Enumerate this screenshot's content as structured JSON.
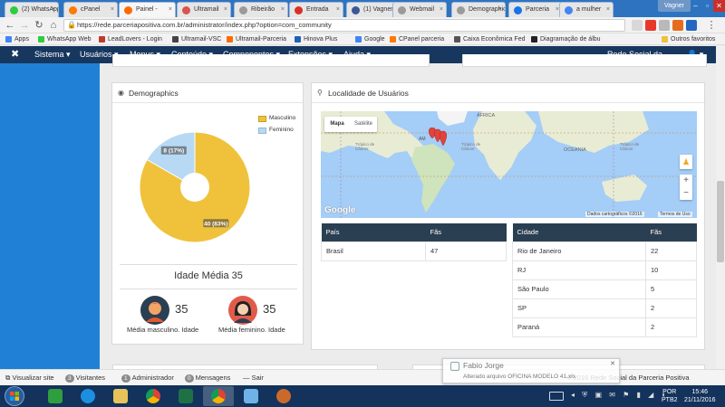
{
  "browser": {
    "tabs": [
      {
        "label": "(2) WhatsApp",
        "color": "#2ecc40"
      },
      {
        "label": "cPanel",
        "color": "#ff7a00"
      },
      {
        "label": "Painel - ",
        "color": "#ff6a00"
      },
      {
        "label": "Ultramail",
        "color": "#d9534f"
      },
      {
        "label": "Ribeirão",
        "color": "#9a9a9a"
      },
      {
        "label": "Entrada",
        "color": "#d93025"
      },
      {
        "label": "(1) Vagner",
        "color": "#3b5998"
      },
      {
        "label": "Webmail",
        "color": "#9a9a9a"
      },
      {
        "label": "Demographics",
        "color": "#9a9a9a"
      },
      {
        "label": "Parceria",
        "color": "#1a73e8"
      },
      {
        "label": "a mulher",
        "color": "#4285f4"
      }
    ],
    "user_name": "Vagner",
    "url": "https://rede.parceriapositiva.com.br/administrator/index.php?option=com_community",
    "bookmarks": [
      {
        "label": "Apps",
        "color": "#4285f4"
      },
      {
        "label": "WhatsApp Web",
        "color": "#2ecc40"
      },
      {
        "label": "LeadLovers - Login",
        "color": "#c0392b"
      },
      {
        "label": "Ultramail-VSC",
        "color": "#444444"
      },
      {
        "label": "Ultramail-Parceria",
        "color": "#ff6a00"
      },
      {
        "label": "Hinova Plus",
        "color": "#1f63b5"
      },
      {
        "label": "Google",
        "color": "#4285f4"
      },
      {
        "label": "CPanel parceria",
        "color": "#ff7a00"
      },
      {
        "label": "Caixa Econômica Fed",
        "color": "#555555"
      },
      {
        "label": "Diagramação de álbu",
        "color": "#222222"
      }
    ],
    "other_bookmarks": "Outros favoritos"
  },
  "admin_nav": {
    "items": [
      "Sistema",
      "Usuários",
      "Menus",
      "Conteúdo",
      "Componentes",
      "Extensões",
      "Ajuda"
    ],
    "site_name": "Rede Social da...",
    "user_icon": "user-icon"
  },
  "demographics": {
    "title": "Demographics",
    "legend": [
      {
        "label": "Masculino",
        "color": "#f0c23b"
      },
      {
        "label": "Feminino",
        "color": "#b8d9f3"
      }
    ],
    "chart_data": {
      "type": "pie",
      "donut": true,
      "categories": [
        "Masculino",
        "Feminino"
      ],
      "values": [
        40,
        8
      ],
      "percentages": [
        83,
        17
      ],
      "labels": [
        "40 (83%)",
        "8 (17%)"
      ],
      "colors": [
        "#f0c23b",
        "#b8d9f3"
      ],
      "legend_position": "top-right"
    },
    "average_title": "Idade Média 35",
    "male_age": "35",
    "male_label": "Média masculino. Idade",
    "female_age": "35",
    "female_label": "Média feminino. Idade"
  },
  "location": {
    "title": "Localidade de Usuários",
    "map_tabs": [
      "Mapa",
      "Satélite"
    ],
    "map_labels": {
      "africa": "ÁFRICA",
      "oceania": "OCEANIA",
      "tropic_north": "Trópico de Câncer",
      "tropic_south": "Trópico de Capricórnio",
      "amer": "AM"
    },
    "map_footer": "Dados cartográficos ©2016",
    "map_terms": "Termos de Uso",
    "google": "Google",
    "countries": {
      "headers": [
        "País",
        "Fãs"
      ],
      "rows": [
        [
          "Brasil",
          "47"
        ]
      ]
    },
    "cities": {
      "headers": [
        "Cidade",
        "Fãs"
      ],
      "rows": [
        [
          "Rio de Janeiro",
          "22"
        ],
        [
          "RJ",
          "10"
        ],
        [
          "São Paulo",
          "5"
        ],
        [
          "SP",
          "2"
        ],
        [
          "Paraná",
          "2"
        ]
      ]
    }
  },
  "status_bar": {
    "view_site": "Visualizar site",
    "visitors_count": "3",
    "visitors": "Visitantes",
    "admin_count": "1",
    "admin": "Administrador",
    "messages_count": "0",
    "messages": "Mensagens",
    "logout": "Sair",
    "right_text": "© 2016 Rede Social da Parceria Positiva"
  },
  "notification": {
    "title": "Fabio Jorge",
    "text": "Alterado arquivo OFICINA MODELO 41.xls"
  },
  "taskbar": {
    "language": "POR",
    "layout": "PTB2",
    "time": "15:46",
    "date": "21/11/2016"
  }
}
